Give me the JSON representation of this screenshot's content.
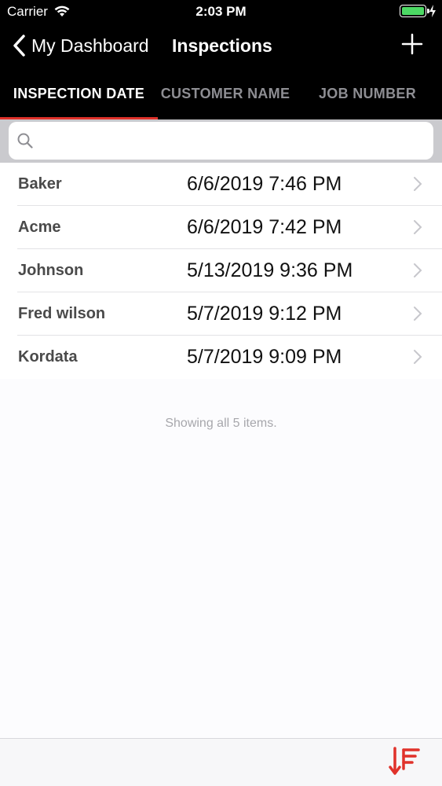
{
  "status_bar": {
    "carrier": "Carrier",
    "time": "2:03 PM",
    "battery_color": "#4cd964"
  },
  "nav": {
    "back_label": "My Dashboard",
    "title": "Inspections"
  },
  "tabs": [
    {
      "label": "INSPECTION DATE",
      "active": true
    },
    {
      "label": "CUSTOMER NAME",
      "active": false
    },
    {
      "label": "JOB NUMBER",
      "active": false
    }
  ],
  "search": {
    "placeholder": "",
    "value": ""
  },
  "inspections": [
    {
      "name": "Baker",
      "date": "6/6/2019 7:46 PM"
    },
    {
      "name": "Acme",
      "date": "6/6/2019 7:42 PM"
    },
    {
      "name": "Johnson",
      "date": "5/13/2019 9:36 PM"
    },
    {
      "name": "Fred wilson",
      "date": "5/7/2019 9:12 PM"
    },
    {
      "name": "Kordata",
      "date": "5/7/2019 9:09 PM"
    }
  ],
  "footer_note": "Showing all 5 items.",
  "colors": {
    "accent": "#e0322b",
    "nav_background": "#000000"
  },
  "icons": {
    "back": "chevron-left-icon",
    "add": "plus-icon",
    "search": "magnifier-icon",
    "row": "chevron-right-icon",
    "sort": "sort-descending-icon"
  }
}
